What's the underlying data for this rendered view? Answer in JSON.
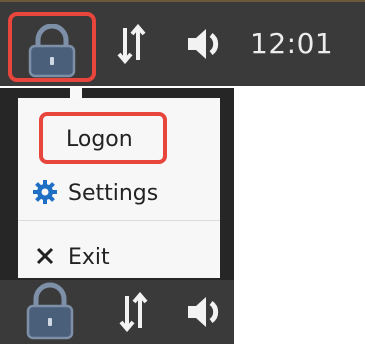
{
  "tray_top": {
    "lock_icon": "padlock-icon",
    "network_icon": "up-down-arrows-icon",
    "volume_icon": "speaker-icon",
    "clock": "12:01"
  },
  "menu": {
    "items": [
      {
        "label": "Logon",
        "icon": "none"
      },
      {
        "label": "Settings",
        "icon": "gear-icon"
      },
      {
        "label": "Exit",
        "icon": "close-x-icon"
      }
    ]
  },
  "tray_bottom": {
    "lock_icon": "padlock-icon",
    "network_icon": "up-down-arrows-icon",
    "volume_icon": "speaker-icon"
  },
  "colors": {
    "tray_bg": "#3a3a3a",
    "highlight": "#e8453c",
    "lock_fill": "#4a5f7a",
    "gear_blue": "#1f6fc4",
    "menu_bg": "#f7f7f7"
  }
}
